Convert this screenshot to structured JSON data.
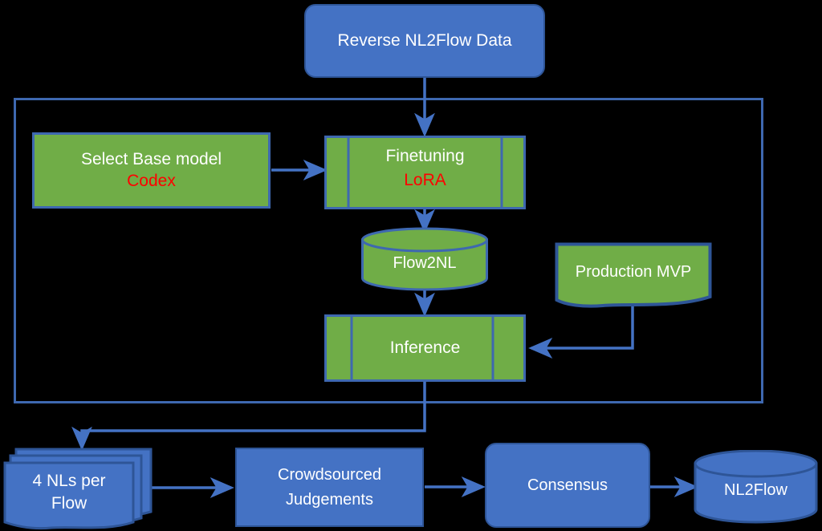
{
  "diagram": {
    "title_node": {
      "label": "Reverse NL2Flow Data"
    },
    "nodes": [
      {
        "id": "reverse-nl2flow-data",
        "label": "Reverse NL2Flow Data",
        "shape": "rounded-rectangle",
        "fill": "#4472C4"
      },
      {
        "id": "select-base-model",
        "label": "Select Base model",
        "sublabel": "Codex",
        "shape": "rectangle",
        "fill": "#70AD47"
      },
      {
        "id": "finetuning",
        "label": "Finetuning",
        "sublabel": "LoRA",
        "shape": "predefined-process",
        "fill": "#70AD47"
      },
      {
        "id": "flow2nl",
        "label": "Flow2NL",
        "shape": "cylinder",
        "fill": "#70AD47"
      },
      {
        "id": "production-mvp",
        "label": "Production MVP",
        "shape": "document",
        "fill": "#70AD47"
      },
      {
        "id": "inference",
        "label": "Inference",
        "shape": "predefined-process",
        "fill": "#70AD47"
      },
      {
        "id": "four-nls-per-flow",
        "label": "4 NLs per Flow",
        "label_line1": "4 NLs per",
        "label_line2": "Flow",
        "shape": "multidocument",
        "fill": "#4472C4"
      },
      {
        "id": "crowdsourced-judgements",
        "label": "Crowdsourced Judgements",
        "label_line1": "Crowdsourced",
        "label_line2": "Judgements",
        "shape": "rectangle",
        "fill": "#4472C4"
      },
      {
        "id": "consensus",
        "label": "Consensus",
        "shape": "rounded-rectangle",
        "fill": "#4472C4"
      },
      {
        "id": "nl2flow",
        "label": "NL2Flow",
        "shape": "cylinder",
        "fill": "#4472C4"
      }
    ],
    "edges": [
      {
        "from": "reverse-nl2flow-data",
        "to": "finetuning"
      },
      {
        "from": "select-base-model",
        "to": "finetuning"
      },
      {
        "from": "finetuning",
        "to": "flow2nl"
      },
      {
        "from": "flow2nl",
        "to": "inference"
      },
      {
        "from": "production-mvp",
        "to": "inference"
      },
      {
        "from": "inference",
        "to": "four-nls-per-flow"
      },
      {
        "from": "four-nls-per-flow",
        "to": "crowdsourced-judgements"
      },
      {
        "from": "crowdsourced-judgements",
        "to": "consensus"
      },
      {
        "from": "consensus",
        "to": "nl2flow"
      }
    ],
    "colors": {
      "background": "#000000",
      "blue_fill": "#4472C4",
      "blue_stroke": "#2E5597",
      "green_fill": "#70AD47",
      "green_stroke": "#3E68B0",
      "connector": "#4472C4",
      "group_border": "#3E68B0",
      "highlight_text": "#FF0000",
      "text": "#FFFFFF"
    },
    "group_container": {
      "label": ""
    }
  }
}
